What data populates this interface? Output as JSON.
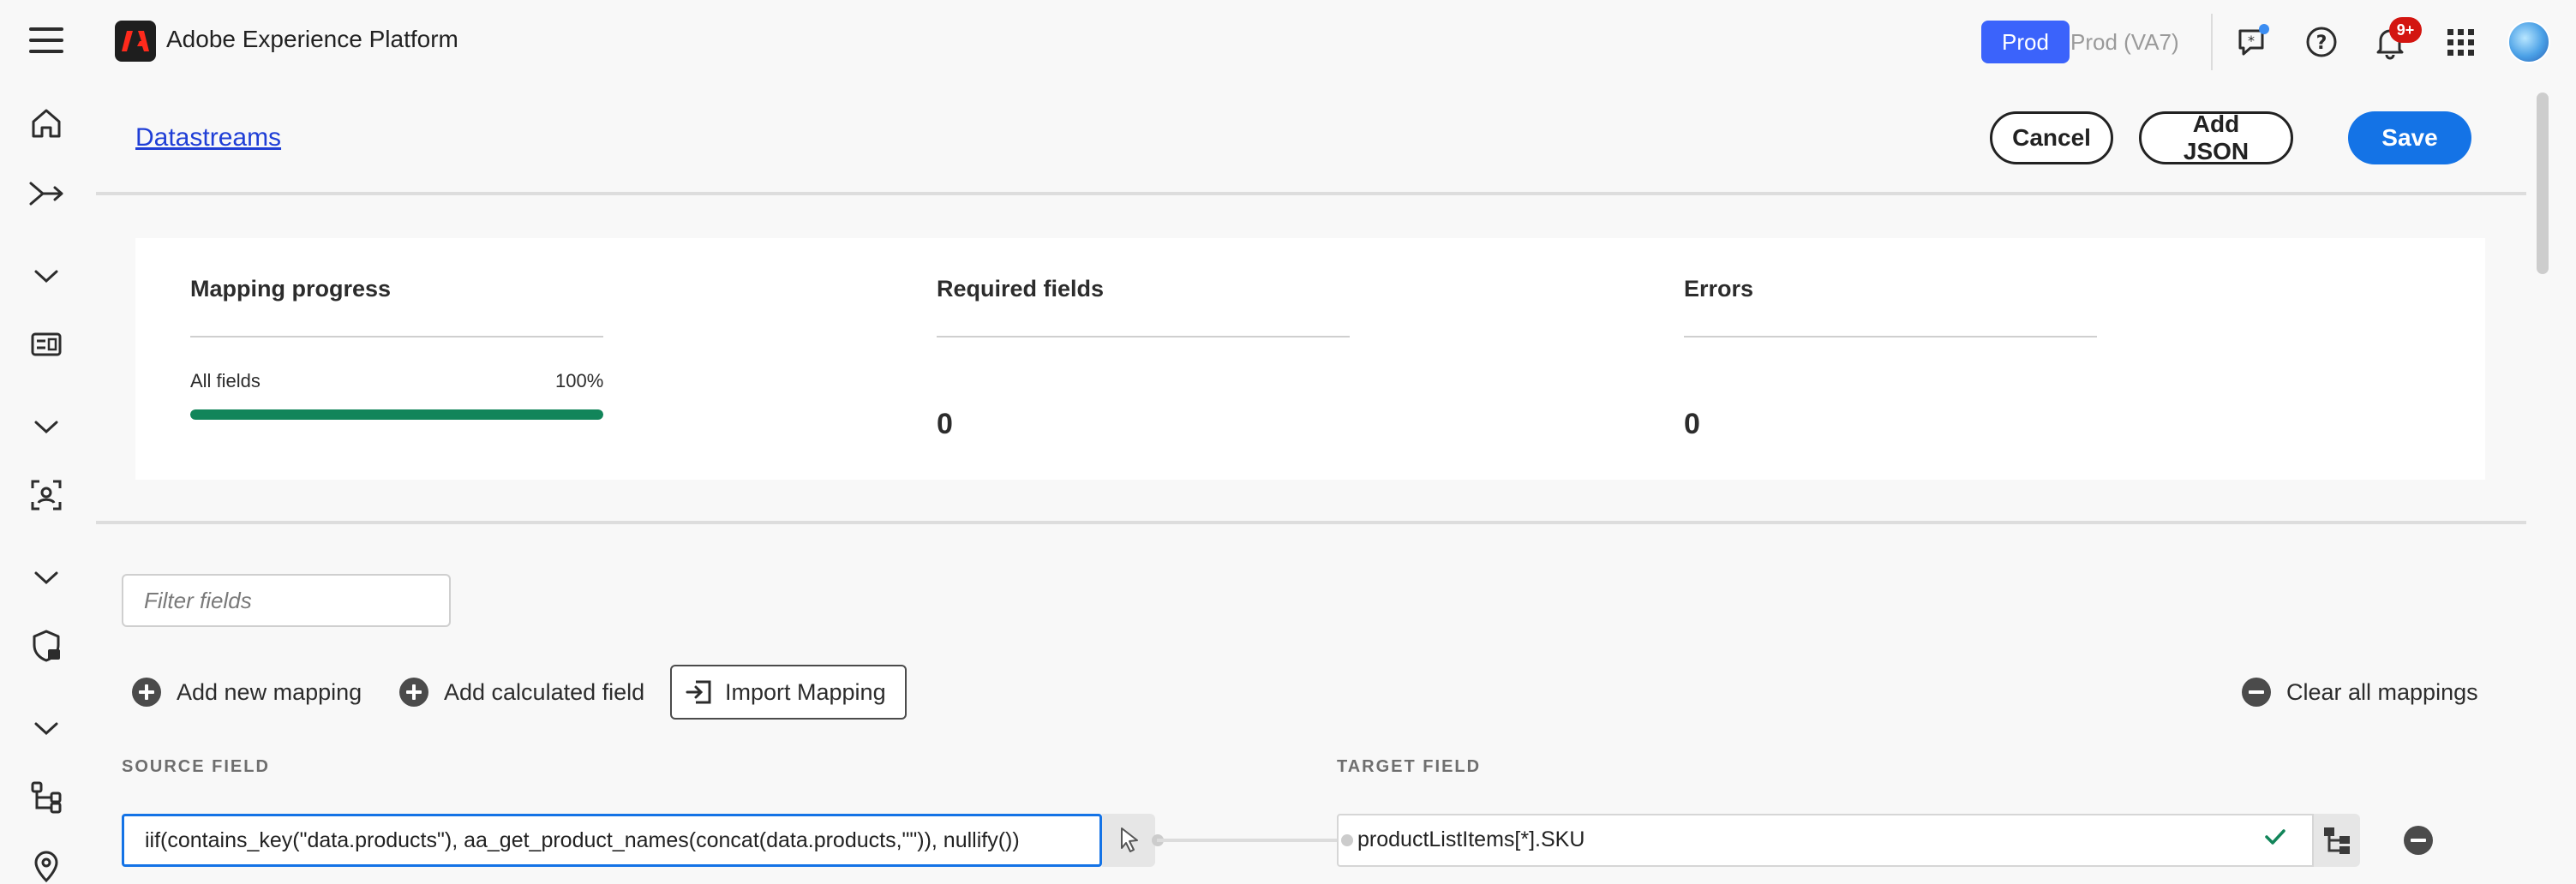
{
  "app": {
    "title": "Adobe Experience Platform"
  },
  "environment": {
    "active": "Prod",
    "inactive": "Prod (VA7)"
  },
  "notifications": {
    "count": "9+"
  },
  "header": {
    "breadcrumb": "Datastreams",
    "cancel_label": "Cancel",
    "add_json_label": "Add JSON",
    "save_label": "Save"
  },
  "progress": {
    "mapping_title": "Mapping progress",
    "all_fields_label": "All fields",
    "all_fields_pct": "100%",
    "all_fields_fraction": 1.0,
    "required_title": "Required fields",
    "required_value": "0",
    "errors_title": "Errors",
    "errors_value": "0"
  },
  "filter": {
    "placeholder": "Filter fields"
  },
  "actions": {
    "add_mapping": "Add new mapping",
    "add_calculated": "Add calculated field",
    "import_mapping": "Import Mapping",
    "clear_all": "Clear all mappings"
  },
  "columns": {
    "source": "SOURCE FIELD",
    "target": "TARGET FIELD"
  },
  "mapping": {
    "source_value": "iif(contains_key(\"data.products\"), aa_get_product_names(concat(data.products,\"\")), nullify())",
    "target_value": "productListItems[*].SKU"
  },
  "colors": {
    "accent": "#1473e6",
    "progress": "#12855a",
    "badge": "#d31510",
    "env": "#3b63fb"
  }
}
